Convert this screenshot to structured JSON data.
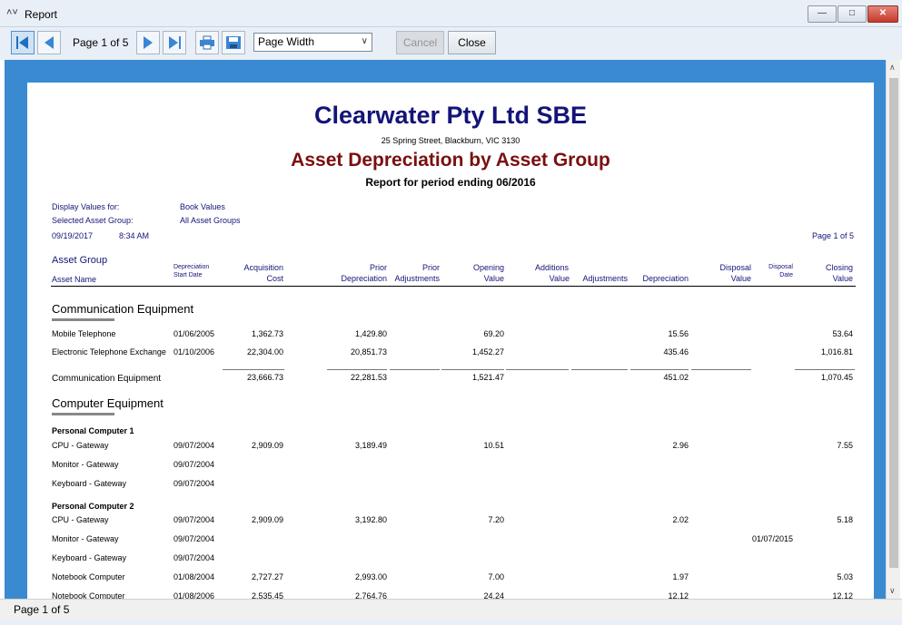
{
  "window": {
    "title": "Report"
  },
  "toolbar": {
    "page_indicator": "Page 1 of 5",
    "zoom_value": "Page Width",
    "cancel_label": "Cancel",
    "close_label": "Close"
  },
  "report": {
    "company": "Clearwater Pty Ltd SBE",
    "address": "25 Spring Street, Blackburn, VIC 3130",
    "title": "Asset Depreciation by Asset Group",
    "period": "Report for period ending 06/2016",
    "meta": {
      "display_label": "Display Values for:",
      "display_value": "Book Values",
      "group_label": "Selected Asset Group:",
      "group_value": "All Asset Groups",
      "date": "09/19/2017",
      "time": "8:34 AM",
      "page": "Page 1 of 5"
    },
    "columns": {
      "asset_group": "Asset Group",
      "asset_name": "Asset Name",
      "dep_start_1": "Depreciation",
      "dep_start_2": "Start Date",
      "acq_1": "Acquisition",
      "acq_2": "Cost",
      "prior_dep_1": "Prior",
      "prior_dep_2": "Depreciation",
      "prior_adj_1": "Prior",
      "prior_adj_2": "Adjustments",
      "opening_1": "Opening",
      "opening_2": "Value",
      "additions_1": "Additions",
      "additions_2": "Value",
      "adjustments": "Adjustments",
      "depreciation": "Depreciation",
      "disposal_value_1": "Disposal",
      "disposal_value_2": "Value",
      "disposal_date_1": "Disposal",
      "disposal_date_2": "Date",
      "closing_1": "Closing",
      "closing_2": "Value"
    },
    "groups": [
      {
        "name": "Communication Equipment",
        "rows": [
          {
            "name": "Mobile Telephone",
            "start": "01/06/2005",
            "acq": "1,362.73",
            "prior_dep": "1,429.80",
            "opening": "69.20",
            "dep": "15.56",
            "closing": "53.64"
          },
          {
            "name": "Electronic Telephone Exchange",
            "start": "01/10/2006",
            "acq": "22,304.00",
            "prior_dep": "20,851.73",
            "opening": "1,452.27",
            "dep": "435.46",
            "closing": "1,016.81"
          }
        ],
        "total": {
          "name": "Communication Equipment",
          "acq": "23,666.73",
          "prior_dep": "22,281.53",
          "opening": "1,521.47",
          "dep": "451.02",
          "closing": "1,070.45"
        }
      },
      {
        "name": "Computer Equipment",
        "subgroups": [
          {
            "name": "Personal Computer 1",
            "rows": [
              {
                "name": "CPU - Gateway",
                "start": "09/07/2004",
                "acq": "2,909.09",
                "prior_dep": "3,189.49",
                "opening": "10.51",
                "dep": "2.96",
                "closing": "7.55"
              },
              {
                "name": "Monitor - Gateway",
                "start": "09/07/2004"
              },
              {
                "name": "Keyboard - Gateway",
                "start": "09/07/2004"
              }
            ]
          },
          {
            "name": "Personal Computer 2",
            "rows": [
              {
                "name": "CPU - Gateway",
                "start": "09/07/2004",
                "acq": "2,909.09",
                "prior_dep": "3,192.80",
                "opening": "7.20",
                "dep": "2.02",
                "closing": "5.18"
              },
              {
                "name": "Monitor - Gateway",
                "start": "09/07/2004",
                "disposal_date": "01/07/2015"
              },
              {
                "name": "Keyboard - Gateway",
                "start": "09/07/2004"
              }
            ]
          }
        ],
        "rows": [
          {
            "name": "Notebook Computer",
            "start": "01/08/2004",
            "acq": "2,727.27",
            "prior_dep": "2,993.00",
            "opening": "7.00",
            "dep": "1.97",
            "closing": "5.03"
          },
          {
            "name": "Notebook Computer",
            "start": "01/08/2006",
            "acq": "2,535.45",
            "prior_dep": "2,764.76",
            "opening": "24.24",
            "dep": "12.12",
            "closing": "12.12"
          }
        ]
      }
    ]
  },
  "status": {
    "text": "Page 1 of 5"
  }
}
